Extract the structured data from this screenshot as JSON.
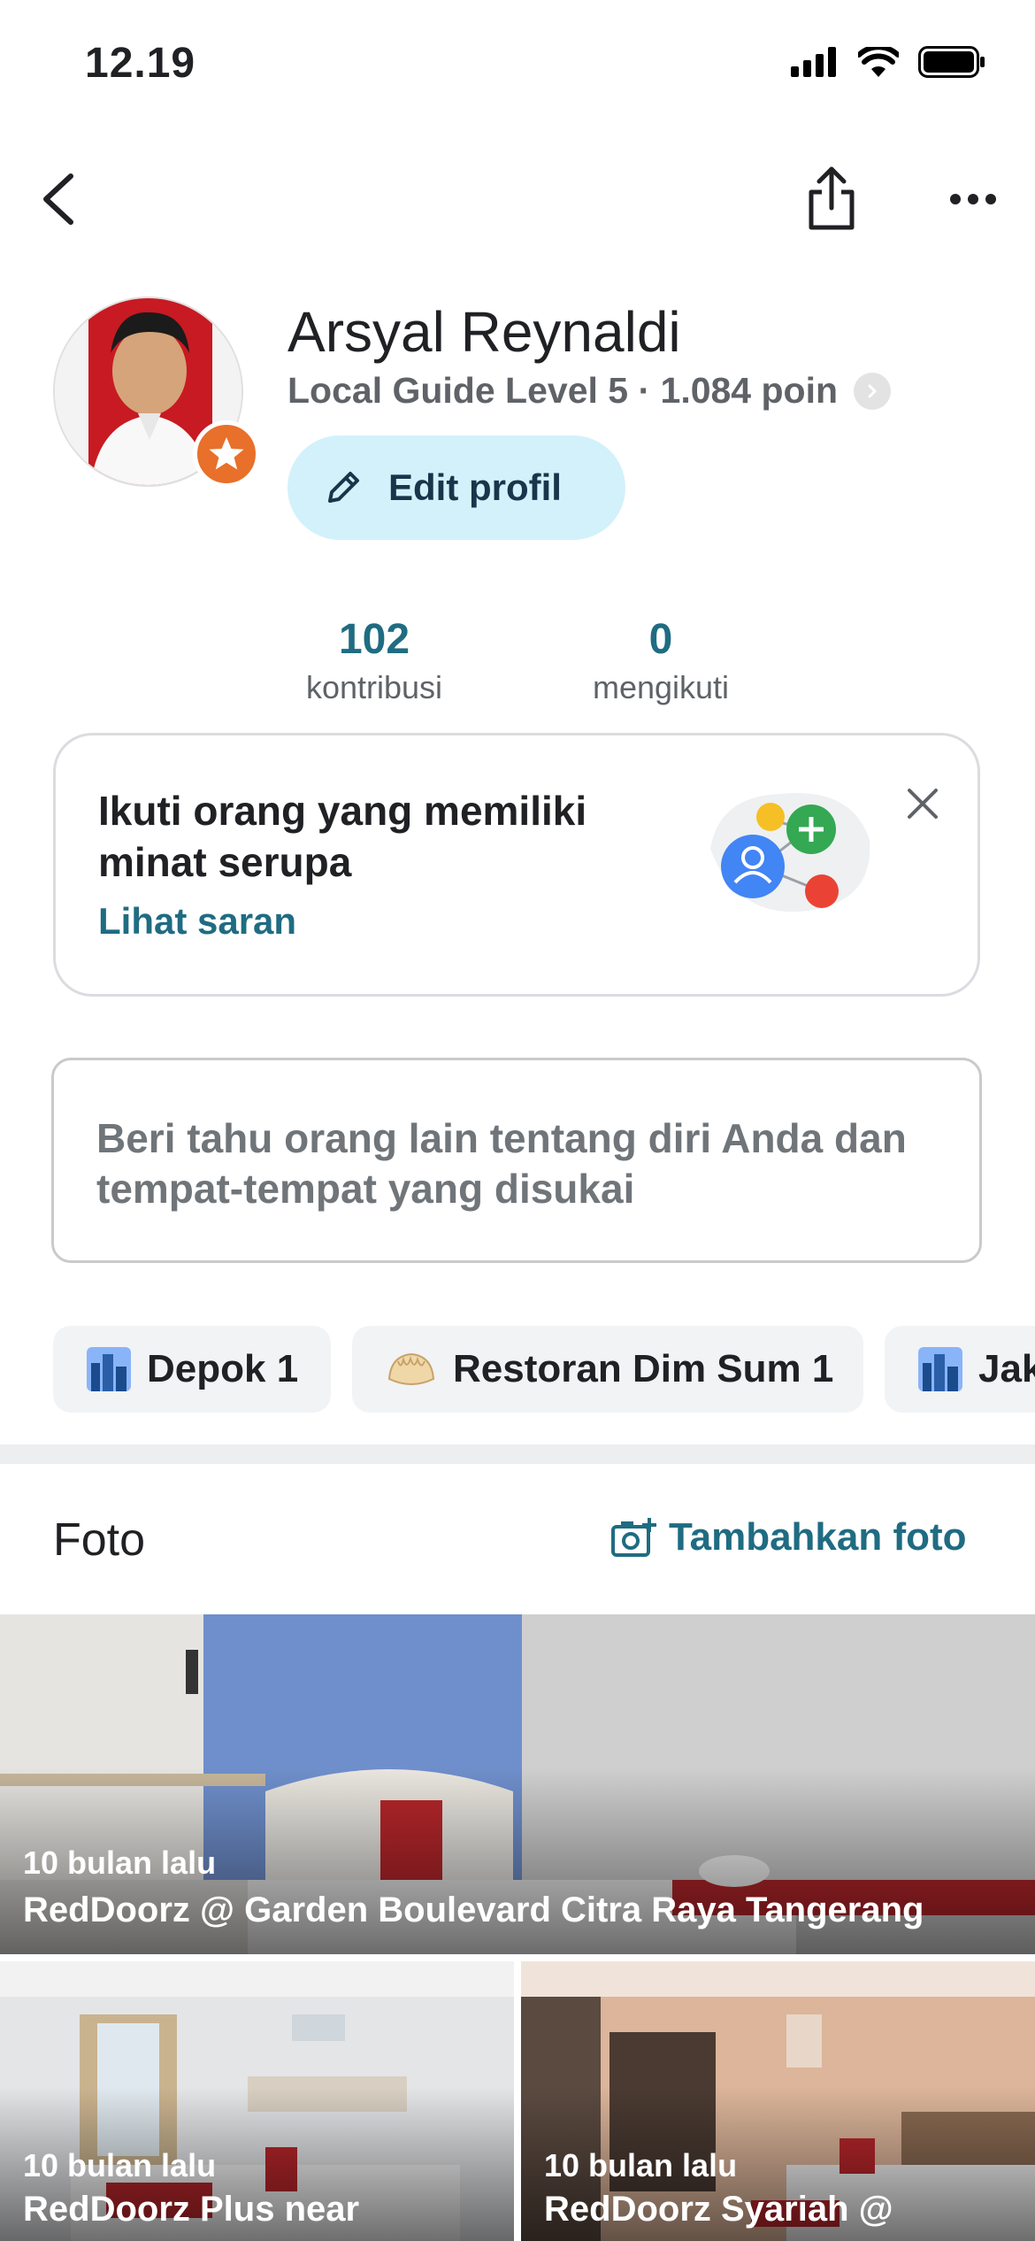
{
  "status_bar": {
    "time": "12.19",
    "icons": [
      "cellular-signal-icon",
      "wifi-icon",
      "battery-icon"
    ]
  },
  "nav": {
    "icons": [
      "back-arrow-icon",
      "share-icon",
      "more-options-icon"
    ]
  },
  "profile": {
    "name": "Arsyal Reynaldi",
    "level_text": "Local Guide Level 5 · 1.084 poin",
    "edit_button_label": "Edit profil",
    "badge_icon": "local-guide-star-icon"
  },
  "stats": [
    {
      "value": "102",
      "label": "kontribusi"
    },
    {
      "value": "0",
      "label": "mengikuti"
    }
  ],
  "follow_card": {
    "title": "Ikuti orang yang memiliki minat serupa",
    "link_label": "Lihat saran",
    "close_icon": "close-icon"
  },
  "bio": {
    "placeholder": "Beri tahu orang lain tentang diri Anda dan tempat-tempat yang disukai"
  },
  "chips": [
    {
      "icon": "city-icon",
      "label": "Depok 1"
    },
    {
      "icon": "dumpling-icon",
      "label": "Restoran Dim Sum 1"
    },
    {
      "icon": "city-icon",
      "label": "Jakarta"
    }
  ],
  "photos": {
    "title": "Foto",
    "add_label": "Tambahkan foto",
    "items": [
      {
        "time": "10 bulan lalu",
        "name": "RedDoorz @ Garden Boulevard Citra Raya Tangerang"
      },
      {
        "time": "10 bulan lalu",
        "name": "RedDoorz Plus near"
      },
      {
        "time": "10 bulan lalu",
        "name": "RedDoorz Syariah @"
      }
    ]
  },
  "colors": {
    "accent_teal": "#1f6c82",
    "edit_button_bg": "#d3f1fb",
    "badge_orange": "#e8702a",
    "chip_bg": "#f1f3f4"
  }
}
